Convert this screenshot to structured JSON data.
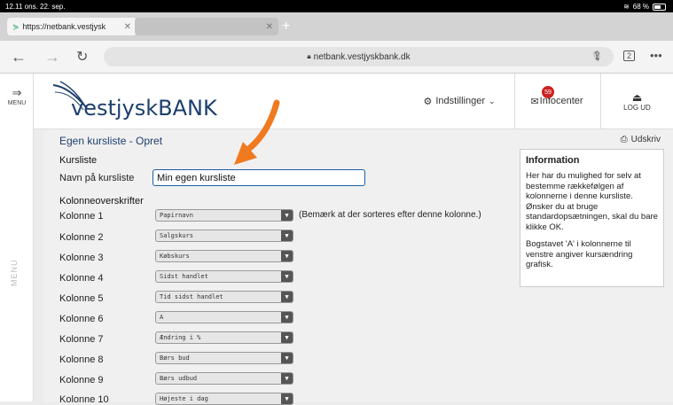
{
  "status": {
    "time": "12.11",
    "date": "ons. 22. sep.",
    "battery": "68 %"
  },
  "tabs": {
    "active_title": "https://netbank.vestjysk",
    "inactive_title": ""
  },
  "browser": {
    "url": "netbank.vestjyskbank.dk",
    "tab_count": "2"
  },
  "site": {
    "logo_part1": "vestjysk",
    "logo_part2": "BANK",
    "menu_label": "MENU",
    "settings_label": "Indstillinger",
    "infocenter_label": "Infocenter",
    "infocenter_badge": "59",
    "logout_label": "LOG UD"
  },
  "page": {
    "title": "Egen kursliste - Opret",
    "print_label": "Udskriv",
    "section_kursliste": "Kursliste",
    "name_label": "Navn på kursliste",
    "name_value": "Min egen kursliste",
    "section_columns": "Kolonneoverskrifter",
    "sort_note": "(Bemærk at der sorteres efter denne kolonne.)",
    "columns": [
      {
        "label": "Kolonne 1",
        "value": "Papirnavn"
      },
      {
        "label": "Kolonne 2",
        "value": "Salgskurs"
      },
      {
        "label": "Kolonne 3",
        "value": "Købskurs"
      },
      {
        "label": "Kolonne 4",
        "value": "Sidst handlet"
      },
      {
        "label": "Kolonne 5",
        "value": "Tid sidst handlet"
      },
      {
        "label": "Kolonne 6",
        "value": "A"
      },
      {
        "label": "Kolonne 7",
        "value": "Ændring i %"
      },
      {
        "label": "Kolonne 8",
        "value": "Børs bud"
      },
      {
        "label": "Kolonne 9",
        "value": "Børs udbud"
      },
      {
        "label": "Kolonne 10",
        "value": "Højeste i dag"
      }
    ]
  },
  "info": {
    "title": "Information",
    "text1": "Her har du mulighed for selv at bestemme rækkefølgen af kolonnerne i denne kursliste. Ønsker du at bruge standardopsætningen, skal du bare klikke OK.",
    "text2": "Bogstavet 'A' i kolonnerne til venstre angiver kursændring grafisk."
  },
  "colors": {
    "brand": "#1c3f6d",
    "arrow": "#f07a20",
    "badge": "#cc2222"
  }
}
